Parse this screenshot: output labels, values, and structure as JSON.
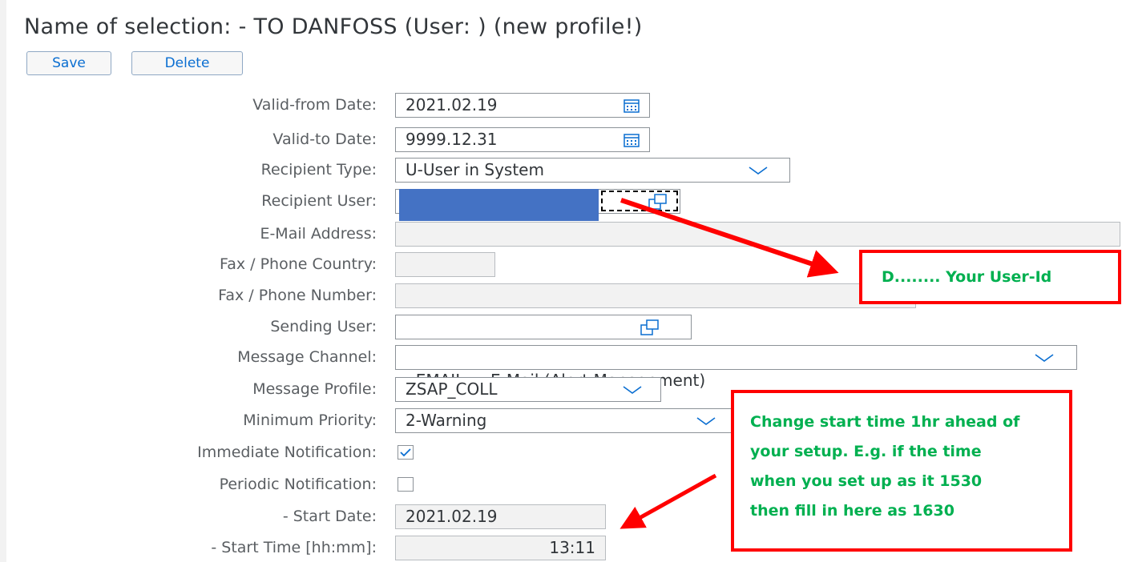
{
  "header": {
    "title": "Name of selection: - TO DANFOSS (User: )  (new profile!)"
  },
  "toolbar": {
    "save_label": "Save",
    "delete_label": "Delete"
  },
  "form": {
    "valid_from": {
      "label": "Valid-from Date:",
      "value": "2021.02.19"
    },
    "valid_to": {
      "label": "Valid-to Date:",
      "value": "9999.12.31"
    },
    "recipient_type": {
      "label": "Recipient Type:",
      "value": "U-User in System"
    },
    "recipient_user": {
      "label": "Recipient User:",
      "value": ""
    },
    "email": {
      "label": "E-Mail Address:",
      "value": ""
    },
    "fax_country": {
      "label": "Fax / Phone Country:",
      "value": ""
    },
    "fax_number": {
      "label": "Fax / Phone Number:",
      "value": ""
    },
    "sending_user": {
      "label": "Sending User:",
      "value": ""
    },
    "message_channel": {
      "label": "Message Channel:",
      "value": "EMAIL    -E-Mail (Alert Management)"
    },
    "message_profile": {
      "label": "Message Profile:",
      "value": "ZSAP_COLL"
    },
    "min_priority": {
      "label": "Minimum Priority:",
      "value": "2-Warning"
    },
    "immediate": {
      "label": "Immediate Notification:",
      "checked": true
    },
    "periodic": {
      "label": "Periodic Notification:",
      "checked": false
    },
    "start_date": {
      "label": "- Start Date:",
      "value": "2021.02.19"
    },
    "start_time": {
      "label": "- Start Time [hh:mm]:",
      "value": "13:11"
    }
  },
  "annotations": {
    "user_id_note": "D........ Your User-Id",
    "start_time_note": [
      "Change start time 1hr ahead of",
      "your setup. E.g. if the time",
      "when you set up as it 1530",
      "then fill in here as 1630"
    ]
  },
  "colors": {
    "accent": "#0a6ed1",
    "annotation_border": "#ff0000",
    "annotation_text": "#00b050",
    "redaction": "#4472c4"
  }
}
